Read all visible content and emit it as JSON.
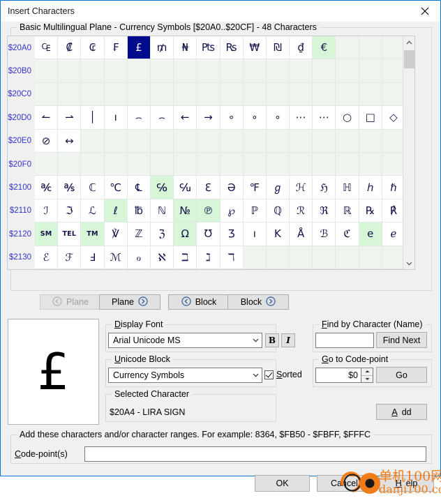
{
  "window": {
    "title": "Insert Characters",
    "close_icon": "close-icon"
  },
  "grid_group": {
    "legend": "Basic Multilingual Plane - Currency Symbols [$20A0..$20CF] - 48 Characters"
  },
  "grid": {
    "rows": [
      {
        "label": "$20A0",
        "cells": [
          {
            "g": "₠",
            "s": "n"
          },
          {
            "g": "₡",
            "s": "n"
          },
          {
            "g": "₢",
            "s": "n"
          },
          {
            "g": "₣",
            "s": "n"
          },
          {
            "g": "£",
            "s": "sel"
          },
          {
            "g": "₥",
            "s": "n"
          },
          {
            "g": "₦",
            "s": "n"
          },
          {
            "g": "₧",
            "s": "n"
          },
          {
            "g": "₨",
            "s": "n"
          },
          {
            "g": "₩",
            "s": "n"
          },
          {
            "g": "₪",
            "s": "n"
          },
          {
            "g": "₫",
            "s": "n"
          },
          {
            "g": "€",
            "s": "green"
          },
          {
            "g": "",
            "s": "e"
          },
          {
            "g": "",
            "s": "e"
          },
          {
            "g": "",
            "s": "e"
          }
        ]
      },
      {
        "label": "$20B0",
        "cells": [
          {
            "g": "",
            "s": "e"
          },
          {
            "g": "",
            "s": "e"
          },
          {
            "g": "",
            "s": "e"
          },
          {
            "g": "",
            "s": "e"
          },
          {
            "g": "",
            "s": "e"
          },
          {
            "g": "",
            "s": "e"
          },
          {
            "g": "",
            "s": "e"
          },
          {
            "g": "",
            "s": "e"
          },
          {
            "g": "",
            "s": "e"
          },
          {
            "g": "",
            "s": "e"
          },
          {
            "g": "",
            "s": "e"
          },
          {
            "g": "",
            "s": "e"
          },
          {
            "g": "",
            "s": "e"
          },
          {
            "g": "",
            "s": "e"
          },
          {
            "g": "",
            "s": "e"
          },
          {
            "g": "",
            "s": "e"
          }
        ]
      },
      {
        "label": "$20C0",
        "cells": [
          {
            "g": "",
            "s": "e"
          },
          {
            "g": "",
            "s": "e"
          },
          {
            "g": "",
            "s": "e"
          },
          {
            "g": "",
            "s": "e"
          },
          {
            "g": "",
            "s": "e"
          },
          {
            "g": "",
            "s": "e"
          },
          {
            "g": "",
            "s": "e"
          },
          {
            "g": "",
            "s": "e"
          },
          {
            "g": "",
            "s": "e"
          },
          {
            "g": "",
            "s": "e"
          },
          {
            "g": "",
            "s": "e"
          },
          {
            "g": "",
            "s": "e"
          },
          {
            "g": "",
            "s": "e"
          },
          {
            "g": "",
            "s": "e"
          },
          {
            "g": "",
            "s": "e"
          },
          {
            "g": "",
            "s": "e"
          }
        ]
      },
      {
        "label": "$20D0",
        "cells": [
          {
            "g": "↼",
            "s": "n"
          },
          {
            "g": "⇀",
            "s": "n"
          },
          {
            "g": "│",
            "s": "n"
          },
          {
            "g": "ı",
            "s": "n"
          },
          {
            "g": "⌢",
            "s": "n"
          },
          {
            "g": "⌢",
            "s": "n"
          },
          {
            "g": "←",
            "s": "n"
          },
          {
            "g": "→",
            "s": "n"
          },
          {
            "g": "∘",
            "s": "n"
          },
          {
            "g": "∘",
            "s": "n"
          },
          {
            "g": "∘",
            "s": "n"
          },
          {
            "g": "⋯",
            "s": "n"
          },
          {
            "g": "⋯",
            "s": "n"
          },
          {
            "g": "○",
            "s": "n"
          },
          {
            "g": "□",
            "s": "n"
          },
          {
            "g": "◇",
            "s": "n"
          }
        ]
      },
      {
        "label": "$20E0",
        "cells": [
          {
            "g": "⊘",
            "s": "n"
          },
          {
            "g": "↔",
            "s": "n"
          },
          {
            "g": "",
            "s": "e"
          },
          {
            "g": "",
            "s": "e"
          },
          {
            "g": "",
            "s": "e"
          },
          {
            "g": "",
            "s": "e"
          },
          {
            "g": "",
            "s": "e"
          },
          {
            "g": "",
            "s": "e"
          },
          {
            "g": "",
            "s": "e"
          },
          {
            "g": "",
            "s": "e"
          },
          {
            "g": "",
            "s": "e"
          },
          {
            "g": "",
            "s": "e"
          },
          {
            "g": "",
            "s": "e"
          },
          {
            "g": "",
            "s": "e"
          },
          {
            "g": "",
            "s": "e"
          },
          {
            "g": "",
            "s": "e"
          }
        ]
      },
      {
        "label": "$20F0",
        "cells": [
          {
            "g": "",
            "s": "e"
          },
          {
            "g": "",
            "s": "e"
          },
          {
            "g": "",
            "s": "e"
          },
          {
            "g": "",
            "s": "e"
          },
          {
            "g": "",
            "s": "e"
          },
          {
            "g": "",
            "s": "e"
          },
          {
            "g": "",
            "s": "e"
          },
          {
            "g": "",
            "s": "e"
          },
          {
            "g": "",
            "s": "e"
          },
          {
            "g": "",
            "s": "e"
          },
          {
            "g": "",
            "s": "e"
          },
          {
            "g": "",
            "s": "e"
          },
          {
            "g": "",
            "s": "e"
          },
          {
            "g": "",
            "s": "e"
          },
          {
            "g": "",
            "s": "e"
          },
          {
            "g": "",
            "s": "e"
          }
        ]
      },
      {
        "label": "$2100",
        "cells": [
          {
            "g": "℀",
            "s": "n"
          },
          {
            "g": "℁",
            "s": "n"
          },
          {
            "g": "ℂ",
            "s": "n"
          },
          {
            "g": "℃",
            "s": "n"
          },
          {
            "g": "℄",
            "s": "n"
          },
          {
            "g": "℅",
            "s": "green"
          },
          {
            "g": "℆",
            "s": "n"
          },
          {
            "g": "ℇ",
            "s": "n"
          },
          {
            "g": "Ə",
            "s": "n"
          },
          {
            "g": "℉",
            "s": "n"
          },
          {
            "g": "ℊ",
            "s": "n"
          },
          {
            "g": "ℋ",
            "s": "n"
          },
          {
            "g": "ℌ",
            "s": "n"
          },
          {
            "g": "ℍ",
            "s": "n"
          },
          {
            "g": "ℎ",
            "s": "n"
          },
          {
            "g": "ℏ",
            "s": "n"
          }
        ]
      },
      {
        "label": "$2110",
        "cells": [
          {
            "g": "ℐ",
            "s": "n"
          },
          {
            "g": "ℑ",
            "s": "n"
          },
          {
            "g": "ℒ",
            "s": "n"
          },
          {
            "g": "ℓ",
            "s": "green"
          },
          {
            "g": "℔",
            "s": "n"
          },
          {
            "g": "ℕ",
            "s": "n"
          },
          {
            "g": "№",
            "s": "green"
          },
          {
            "g": "℗",
            "s": "green"
          },
          {
            "g": "℘",
            "s": "n"
          },
          {
            "g": "ℙ",
            "s": "n"
          },
          {
            "g": "ℚ",
            "s": "n"
          },
          {
            "g": "ℛ",
            "s": "n"
          },
          {
            "g": "ℜ",
            "s": "n"
          },
          {
            "g": "ℝ",
            "s": "n"
          },
          {
            "g": "℞",
            "s": "n"
          },
          {
            "g": "℟",
            "s": "n"
          }
        ]
      },
      {
        "label": "$2120",
        "cells": [
          {
            "g": "SM",
            "s": "green small"
          },
          {
            "g": "TEL",
            "s": "n small"
          },
          {
            "g": "TM",
            "s": "green small"
          },
          {
            "g": "℣",
            "s": "n"
          },
          {
            "g": "ℤ",
            "s": "n"
          },
          {
            "g": "ℨ",
            "s": "n"
          },
          {
            "g": "Ω",
            "s": "green"
          },
          {
            "g": "Ʊ",
            "s": "n"
          },
          {
            "g": "Ʒ",
            "s": "n"
          },
          {
            "g": "ı",
            "s": "n"
          },
          {
            "g": "K",
            "s": "n"
          },
          {
            "g": "Å",
            "s": "n"
          },
          {
            "g": "ℬ",
            "s": "n"
          },
          {
            "g": "ℭ",
            "s": "n"
          },
          {
            "g": "e",
            "s": "green"
          },
          {
            "g": "ℯ",
            "s": "n"
          }
        ]
      },
      {
        "label": "$2130",
        "cells": [
          {
            "g": "ℰ",
            "s": "n"
          },
          {
            "g": "ℱ",
            "s": "n"
          },
          {
            "g": "Ⅎ",
            "s": "n"
          },
          {
            "g": "ℳ",
            "s": "n"
          },
          {
            "g": "ℴ",
            "s": "n"
          },
          {
            "g": "ℵ",
            "s": "n"
          },
          {
            "g": "ℶ",
            "s": "n"
          },
          {
            "g": "ℷ",
            "s": "n"
          },
          {
            "g": "ℸ",
            "s": "n"
          },
          {
            "g": "",
            "s": "e"
          },
          {
            "g": "",
            "s": "e"
          },
          {
            "g": "",
            "s": "e"
          },
          {
            "g": "",
            "s": "e"
          },
          {
            "g": "",
            "s": "e"
          },
          {
            "g": "",
            "s": "e"
          },
          {
            "g": "",
            "s": "e"
          }
        ]
      }
    ]
  },
  "scrollbar": {
    "up_icon": "chevron-up-icon",
    "down_icon": "chevron-down-icon"
  },
  "nav": {
    "plane_prev": "Plane",
    "plane_next": "Plane",
    "block_prev": "Block",
    "block_next": "Block"
  },
  "preview": {
    "character": "£"
  },
  "display_font": {
    "legend": "Display Font",
    "value": "Arial Unicode MS",
    "bold_label": "B",
    "italic_label": "I"
  },
  "unicode_block": {
    "legend": "Unicode Block",
    "value": "Currency Symbols",
    "sorted_label": "Sorted",
    "sorted_checked": true
  },
  "selected_character": {
    "legend": "Selected Character",
    "value": "$20A4 - LIRA SIGN"
  },
  "find_by_character": {
    "legend": "Find by Character (Name)",
    "input_value": "",
    "button_label": "Find Next"
  },
  "goto_codepoint": {
    "legend": "Go to Code-point",
    "input_value": "$0",
    "button_label": "Go"
  },
  "add_button": {
    "label": "Add"
  },
  "add_range": {
    "legend": "Add these characters and/or character ranges. For example: 8364, $FB50 - $FBFF, $FFFC",
    "field_label": "Code-point(s)",
    "input_value": ""
  },
  "footer": {
    "ok": "OK",
    "cancel": "Cancel",
    "help": "Help"
  },
  "watermark": {
    "line1": "单机100网",
    "line2": "danji100.com"
  }
}
